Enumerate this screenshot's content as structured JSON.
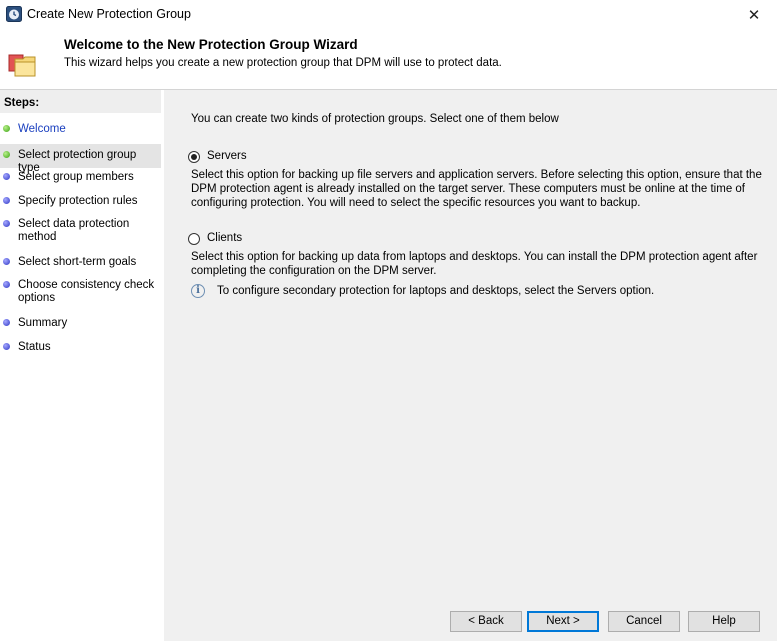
{
  "window": {
    "title": "Create New Protection Group",
    "close_glyph": "✕",
    "app_icon": "dpm-app-icon"
  },
  "header": {
    "title": "Welcome to the New Protection Group Wizard",
    "subtitle": "This wizard helps you create a new protection group that DPM will use to protect data.",
    "icon": "protection-group-folder-icon"
  },
  "steps": {
    "heading": "Steps:",
    "items": [
      {
        "label": "Welcome",
        "status": "done"
      },
      {
        "label": "Select protection group type",
        "status": "current"
      },
      {
        "label": "Select group members",
        "status": "pending"
      },
      {
        "label": "Specify protection rules",
        "status": "pending"
      },
      {
        "label": "Select data protection method",
        "status": "pending"
      },
      {
        "label": "Select short-term goals",
        "status": "pending"
      },
      {
        "label": "Choose consistency check options",
        "status": "pending"
      },
      {
        "label": "Summary",
        "status": "pending"
      },
      {
        "label": "Status",
        "status": "pending"
      }
    ]
  },
  "main": {
    "intro": "You can create two kinds of protection groups. Select one of them below",
    "options": [
      {
        "label": "Servers",
        "selected": true,
        "description": "Select this option for backing up file servers and application servers. Before selecting this option, ensure that the DPM protection agent is already installed on the target server. These computers must be online at the time of configuring protection. You will need to select the specific resources you want to backup."
      },
      {
        "label": "Clients",
        "selected": false,
        "description": "Select this option for backing up data from laptops and desktops. You can install the DPM protection agent after completing the configuration on the DPM server."
      }
    ],
    "info_glyph": "i",
    "info": "To configure secondary protection for laptops and desktops, select the Servers option."
  },
  "buttons": {
    "back": "< Back",
    "next": "Next >",
    "cancel": "Cancel",
    "help": "Help"
  },
  "colors": {
    "done_dot": "#3aa212",
    "pending_dot": "#2d36c4",
    "link_text": "#1a3fbf",
    "default_button_border": "#0078d7"
  }
}
